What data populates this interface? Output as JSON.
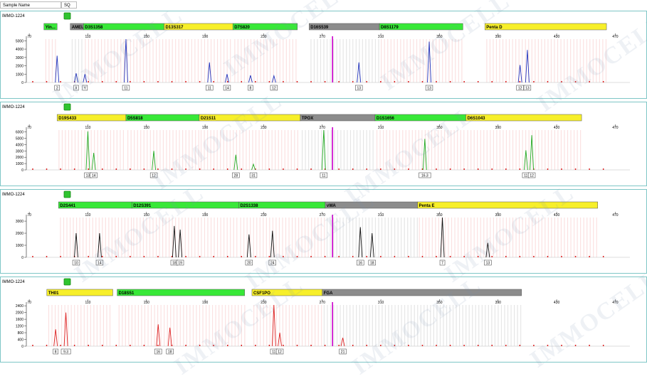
{
  "header": {
    "sample_name_label": "Sample Name",
    "sample_value": "SQ"
  },
  "colors": {
    "blue": "#2233bb",
    "green": "#22aa22",
    "black": "#111111",
    "red": "#dd2222",
    "marker": "#cc00cc",
    "yellow_bin": "#f7ef2a",
    "green_bin": "#38e838",
    "gray_bin": "#8c8c8c"
  },
  "icon": "green-square-icon",
  "watermark": "IMMOCELL",
  "chart_data": [
    {
      "type": "line",
      "sample": "IMMO-1224",
      "color": "#2233bb",
      "x_ticks": [
        70,
        110,
        150,
        190,
        230,
        270,
        310,
        350,
        390,
        430,
        470
      ],
      "xlim": [
        68,
        480
      ],
      "y_ticks": [
        0,
        1000,
        2000,
        3000,
        4000,
        5000
      ],
      "ylim": [
        0,
        5200
      ],
      "loci": [
        {
          "name": "Yin...",
          "start": 80,
          "end": 89,
          "color": "green"
        },
        {
          "name": "AMEL",
          "start": 98,
          "end": 107,
          "color": "gray"
        },
        {
          "name": "D3S1358",
          "start": 107,
          "end": 162,
          "color": "green"
        },
        {
          "name": "D13S317",
          "start": 162,
          "end": 209,
          "color": "yellow"
        },
        {
          "name": "D7S820",
          "start": 209,
          "end": 253,
          "color": "green"
        },
        {
          "name": "D16S539",
          "start": 261,
          "end": 309,
          "color": "gray"
        },
        {
          "name": "D8S1179",
          "start": 309,
          "end": 366,
          "color": "green"
        },
        {
          "name": "Penta D",
          "start": 381,
          "end": 464,
          "color": "yellow"
        }
      ],
      "peaks": [
        {
          "x": 89,
          "height": 3200,
          "label": "2"
        },
        {
          "x": 102,
          "height": 1100,
          "label": "X"
        },
        {
          "x": 108,
          "height": 1000,
          "label": "Y"
        },
        {
          "x": 136,
          "height": 5200,
          "label": "11"
        },
        {
          "x": 193,
          "height": 2400,
          "label": "11"
        },
        {
          "x": 205,
          "height": 1000,
          "label": "14"
        },
        {
          "x": 221,
          "height": 850,
          "label": "8"
        },
        {
          "x": 237,
          "height": 800,
          "label": "12"
        },
        {
          "x": 295,
          "height": 2400,
          "label": "13"
        },
        {
          "x": 343,
          "height": 4900,
          "label": "13"
        },
        {
          "x": 405,
          "height": 2100,
          "label": "12"
        },
        {
          "x": 410,
          "height": 3900,
          "label": "13"
        }
      ]
    },
    {
      "type": "line",
      "sample": "IMMO-1224",
      "color": "#22aa22",
      "x_ticks": [
        70,
        110,
        150,
        190,
        230,
        270,
        310,
        350,
        390,
        430,
        470
      ],
      "xlim": [
        68,
        480
      ],
      "y_ticks": [
        0,
        1000,
        2000,
        3000,
        4000,
        5000,
        6000
      ],
      "ylim": [
        0,
        6300
      ],
      "loci": [
        {
          "name": "D19S433",
          "start": 89,
          "end": 136,
          "color": "yellow"
        },
        {
          "name": "D5S818",
          "start": 136,
          "end": 186,
          "color": "green"
        },
        {
          "name": "D21S11",
          "start": 186,
          "end": 255,
          "color": "yellow"
        },
        {
          "name": "TPOX",
          "start": 255,
          "end": 306,
          "color": "gray"
        },
        {
          "name": "D1S1656",
          "start": 306,
          "end": 368,
          "color": "green"
        },
        {
          "name": "D6S1043",
          "start": 368,
          "end": 447,
          "color": "yellow"
        }
      ],
      "peaks": [
        {
          "x": 110,
          "height": 6100,
          "label": "13"
        },
        {
          "x": 114,
          "height": 2700,
          "label": "14"
        },
        {
          "x": 155,
          "height": 3000,
          "label": "12"
        },
        {
          "x": 211,
          "height": 2400,
          "label": "28"
        },
        {
          "x": 223,
          "height": 900,
          "label": "31"
        },
        {
          "x": 271,
          "height": 6300,
          "label": "11"
        },
        {
          "x": 340,
          "height": 4900,
          "label": "16.3"
        },
        {
          "x": 409,
          "height": 3100,
          "label": "11"
        },
        {
          "x": 413,
          "height": 5500,
          "label": "12"
        }
      ]
    },
    {
      "type": "line",
      "sample": "IMMO-1224",
      "color": "#111111",
      "x_ticks": [
        70,
        110,
        150,
        190,
        230,
        270,
        310,
        350,
        390,
        430,
        470
      ],
      "xlim": [
        68,
        480
      ],
      "y_ticks": [
        0,
        1000,
        2000,
        3000
      ],
      "ylim": [
        0,
        3300
      ],
      "loci": [
        {
          "name": "D2S441",
          "start": 90,
          "end": 140,
          "color": "green"
        },
        {
          "name": "D12S391",
          "start": 140,
          "end": 213,
          "color": "green"
        },
        {
          "name": "D2S1338",
          "start": 213,
          "end": 272,
          "color": "green"
        },
        {
          "name": "vWA",
          "start": 272,
          "end": 335,
          "color": "gray"
        },
        {
          "name": "Penta E",
          "start": 335,
          "end": 458,
          "color": "yellow"
        }
      ],
      "peaks": [
        {
          "x": 102,
          "height": 2000,
          "label": "10"
        },
        {
          "x": 118,
          "height": 2000,
          "label": "14"
        },
        {
          "x": 169,
          "height": 2600,
          "label": "18"
        },
        {
          "x": 173,
          "height": 2300,
          "label": "19"
        },
        {
          "x": 220,
          "height": 1900,
          "label": "20"
        },
        {
          "x": 236,
          "height": 2200,
          "label": "24"
        },
        {
          "x": 296,
          "height": 2500,
          "label": "16"
        },
        {
          "x": 304,
          "height": 2000,
          "label": "18"
        },
        {
          "x": 352,
          "height": 3300,
          "label": "7"
        },
        {
          "x": 383,
          "height": 1200,
          "label": "13"
        }
      ]
    },
    {
      "type": "line",
      "sample": "IMMO-1224",
      "color": "#dd2222",
      "x_ticks": [
        70,
        110,
        150,
        190,
        230,
        270,
        310,
        350,
        390,
        430,
        470
      ],
      "xlim": [
        68,
        480
      ],
      "y_ticks": [
        0,
        400,
        800,
        1200,
        1600,
        2000,
        2400
      ],
      "ylim": [
        0,
        2450
      ],
      "loci": [
        {
          "name": "TH01",
          "start": 82,
          "end": 127,
          "color": "yellow"
        },
        {
          "name": "D18S51",
          "start": 130,
          "end": 217,
          "color": "green"
        },
        {
          "name": "CSF1PO",
          "start": 222,
          "end": 270,
          "color": "yellow"
        },
        {
          "name": "FGA",
          "start": 270,
          "end": 406,
          "color": "gray"
        }
      ],
      "peaks": [
        {
          "x": 88,
          "height": 1000,
          "label": "8"
        },
        {
          "x": 95,
          "height": 2000,
          "label": "9.3"
        },
        {
          "x": 158,
          "height": 1300,
          "label": "16"
        },
        {
          "x": 166,
          "height": 1100,
          "label": "18"
        },
        {
          "x": 237,
          "height": 2450,
          "label": "11"
        },
        {
          "x": 241,
          "height": 800,
          "label": "12"
        },
        {
          "x": 284,
          "height": 500,
          "label": "21"
        }
      ]
    }
  ]
}
